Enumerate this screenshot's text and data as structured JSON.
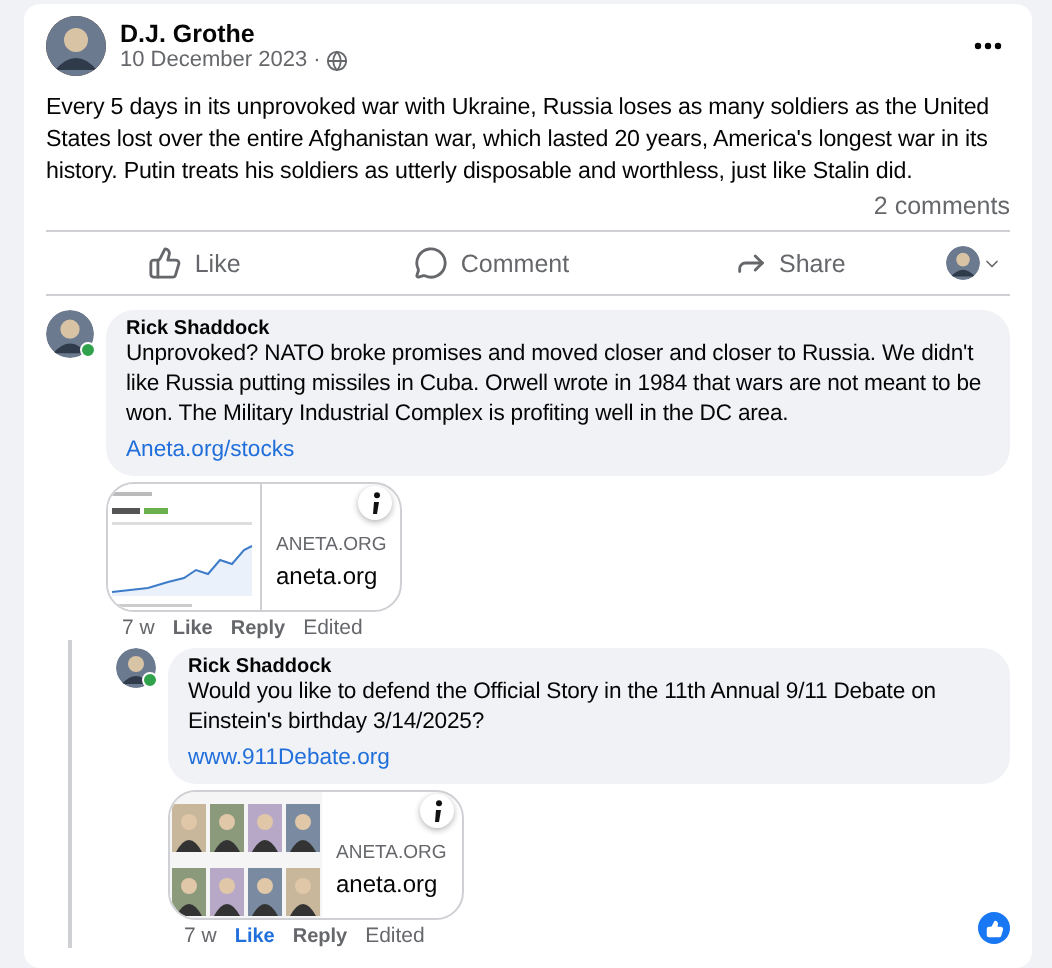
{
  "post": {
    "author": "D.J. Grothe",
    "date": "10 December 2023 ·",
    "text": "Every 5 days in its unprovoked war with Ukraine, Russia loses as many soldiers as the United States lost over the entire Afghanistan war, which lasted 20 years, America's longest war in its history. Putin treats his soldiers as utterly disposable and worthless, just like Stalin did.",
    "comment_count": "2 comments",
    "actions": [
      {
        "kind": "like",
        "label": "Like"
      },
      {
        "kind": "comment",
        "label": "Comment"
      },
      {
        "kind": "share",
        "label": "Share"
      }
    ]
  },
  "comments": [
    {
      "author": "Rick Shaddock",
      "online": true,
      "text": "Unprovoked? NATO broke promises and moved closer and closer to Russia. We didn't like Russia putting missiles in Cuba. Orwell wrote in 1984 that wars are not meant to be won. The Military Industrial Complex is profiting well in the DC area.",
      "link": "Aneta.org/stocks",
      "preview": {
        "site": "ANETA.ORG",
        "domain": "aneta.org"
      },
      "time": "7 w",
      "like": {
        "label": "Like",
        "selected": false
      },
      "reply": "Reply",
      "edited": "Edited",
      "reacted": false,
      "children": [
        {
          "author": "Rick Shaddock",
          "online": true,
          "text": "Would you like to defend the Official Story in the 11th Annual 9/11 Debate on Einstein's birthday 3/14/2025?",
          "link": "www.911Debate.org",
          "preview": {
            "site": "ANETA.ORG",
            "domain": "aneta.org"
          },
          "time": "7 w",
          "like": {
            "label": "Like",
            "selected": true
          },
          "reply": "Reply",
          "edited": "Edited",
          "reacted": true
        }
      ]
    }
  ]
}
